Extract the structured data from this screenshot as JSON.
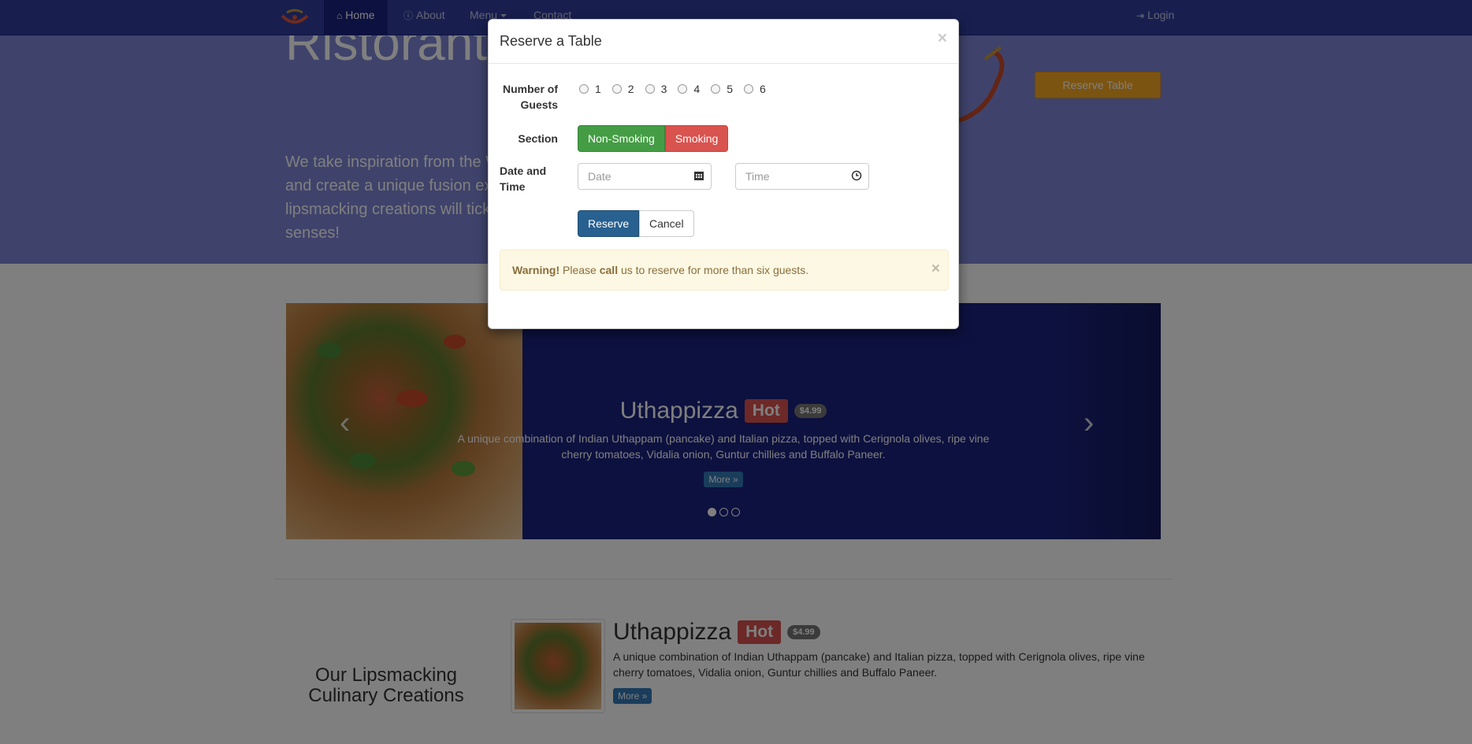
{
  "nav": {
    "items": [
      {
        "label": "Home",
        "icon": "home-icon",
        "active": true
      },
      {
        "label": "About",
        "icon": "info-icon"
      },
      {
        "label": "Menu",
        "icon": "caret-down-icon"
      },
      {
        "label": "Contact"
      }
    ],
    "login": "Login"
  },
  "jumbotron": {
    "title": "Ristorante con Fusion",
    "text": "We take inspiration from the World's best cuisines, and create a unique fusion experience. Our lipsmacking creations will tickle your culinary senses!",
    "reserve_button": "Reserve Table"
  },
  "carousel": {
    "title": "Uthappizza",
    "label": "Hot",
    "price": "$4.99",
    "description": "A unique combination of Indian Uthappam (pancake) and Italian pizza, topped with Cerignola olives, ripe vine cherry tomatoes, Vidalia onion, Guntur chillies and Buffalo Paneer.",
    "more": "More »"
  },
  "featured": {
    "heading": "Our Lipsmacking Culinary Creations",
    "title": "Uthappizza",
    "label": "Hot",
    "price": "$4.99",
    "description": "A unique combination of Indian Uthappam (pancake) and Italian pizza, topped with Cerignola olives, ripe vine cherry tomatoes, Vidalia onion, Guntur chillies and Buffalo Paneer.",
    "more": "More »"
  },
  "modal": {
    "title": "Reserve a Table",
    "close": "×",
    "guests_label": "Number of Guests",
    "guest_options": [
      "1",
      "2",
      "3",
      "4",
      "5",
      "6"
    ],
    "section_label": "Section",
    "section_options": [
      "Non-Smoking",
      "Smoking"
    ],
    "datetime_label": "Date and Time",
    "date_placeholder": "Date",
    "time_placeholder": "Time",
    "reserve": "Reserve",
    "cancel": "Cancel",
    "alert": {
      "strong": "Warning!",
      "pre": "Please",
      "call": "call",
      "post": "us to reserve for more than six guests.",
      "close": "×"
    }
  },
  "colors": {
    "navbar": "#303F9F",
    "navbar_active": "#1A237E",
    "jumbotron": "#9575CD",
    "accent": "#F9A825",
    "carousel_bg": "#1A237E"
  }
}
